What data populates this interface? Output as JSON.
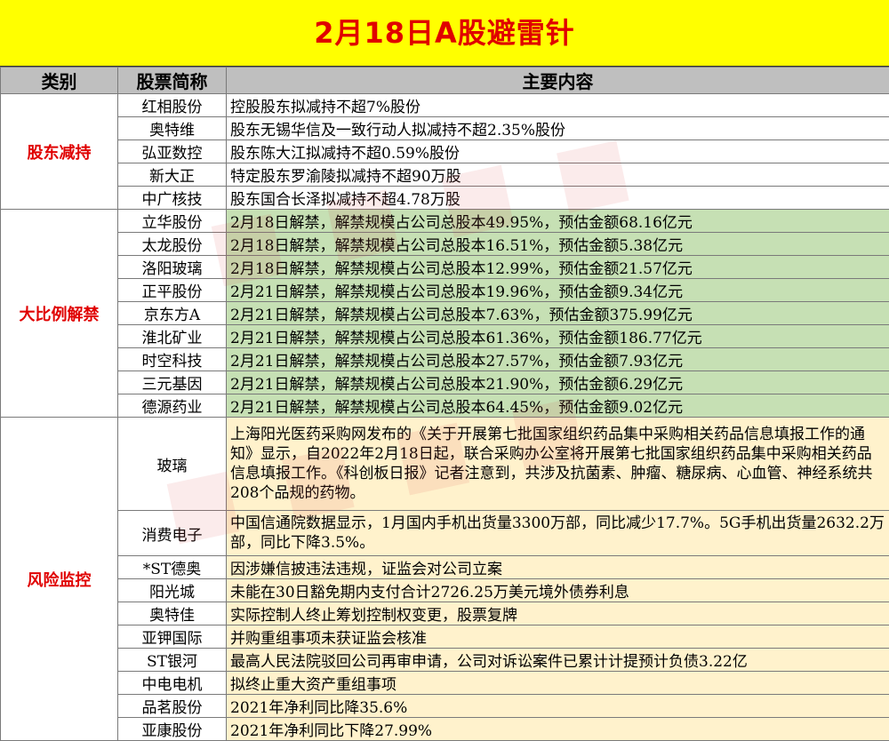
{
  "title": "2月18日A股避雷针",
  "headers": {
    "category": "类别",
    "stock": "股票简称",
    "content": "主要内容"
  },
  "groups": {
    "shareholder_reduction": {
      "label": "股东减持",
      "rows": [
        {
          "stock": "红相股份",
          "content": "控股股东拟减持不超7%股份"
        },
        {
          "stock": "奥特维",
          "content": "股东无锡华信及一致行动人拟减持不超2.35%股份"
        },
        {
          "stock": "弘亚数控",
          "content": "股东陈大江拟减持不超0.59%股份"
        },
        {
          "stock": "新大正",
          "content": "特定股东罗渝陵拟减持不超90万股"
        },
        {
          "stock": "中广核技",
          "content": "股东国合长泽拟减持不超4.78万股"
        }
      ]
    },
    "large_unlock": {
      "label": "大比例解禁",
      "rows": [
        {
          "stock": "立华股份",
          "content": "2月18日解禁，解禁规模占公司总股本49.95%，预估金额68.16亿元"
        },
        {
          "stock": "太龙股份",
          "content": "2月18日解禁，解禁规模占公司总股本16.51%，预估金额5.38亿元"
        },
        {
          "stock": "洛阳玻璃",
          "content": "2月18日解禁，解禁规模占公司总股本12.99%，预估金额21.57亿元"
        },
        {
          "stock": "正平股份",
          "content": "2月21日解禁，解禁规模占公司总股本19.96%，预估金额9.34亿元"
        },
        {
          "stock": "京东方A",
          "content": "2月21日解禁，解禁规模占公司总股本7.63%，预估金额375.99亿元"
        },
        {
          "stock": "淮北矿业",
          "content": "2月21日解禁，解禁规模占公司总股本61.36%，预估金额186.77亿元"
        },
        {
          "stock": "时空科技",
          "content": "2月21日解禁，解禁规模占公司总股本27.57%，预估金额7.93亿元"
        },
        {
          "stock": "三元基因",
          "content": "2月21日解禁，解禁规模占公司总股本21.90%，预估金额6.29亿元"
        },
        {
          "stock": "德源药业",
          "content": "2月21日解禁，解禁规模占公司总股本64.45%，预估金额9.02亿元"
        }
      ]
    },
    "risk_monitor": {
      "label": "风险监控",
      "rows": [
        {
          "stock": "玻璃",
          "content": "上海阳光医药采购网发布的《关于开展第七批国家组织药品集中采购相关药品信息填报工作的通知》显示，自2022年2月18日起，联合采购办公室将开展第七批国家组织药品集中采购相关药品信息填报工作。《科创板日报》记者注意到，共涉及抗菌素、肿瘤、糖尿病、心血管、神经系统共208个品规的药物。"
        },
        {
          "stock": "消费电子",
          "content": "中国信通院数据显示，1月国内手机出货量3300万部，同比减少17.7%。5G手机出货量2632.2万部，同比下降3.5%。"
        },
        {
          "stock": "*ST德奥",
          "content": "因涉嫌信披违法违规，证监会对公司立案"
        },
        {
          "stock": "阳光城",
          "content": "未能在30日豁免期内支付合计2726.25万美元境外债券利息"
        },
        {
          "stock": "奥特佳",
          "content": "实际控制人终止筹划控制权变更，股票复牌"
        },
        {
          "stock": "亚钾国际",
          "content": "并购重组事项未获证监会核准"
        },
        {
          "stock": "ST银河",
          "content": "最高人民法院驳回公司再审申请，公司对诉讼案件已累计计提预计负债3.22亿"
        },
        {
          "stock": "中电电机",
          "content": "拟终止重大资产重组事项"
        },
        {
          "stock": "品茗股份",
          "content": "2021年净利同比降35.6%"
        },
        {
          "stock": "亚康股份",
          "content": "2021年净利同比下降27.99%"
        }
      ]
    }
  }
}
